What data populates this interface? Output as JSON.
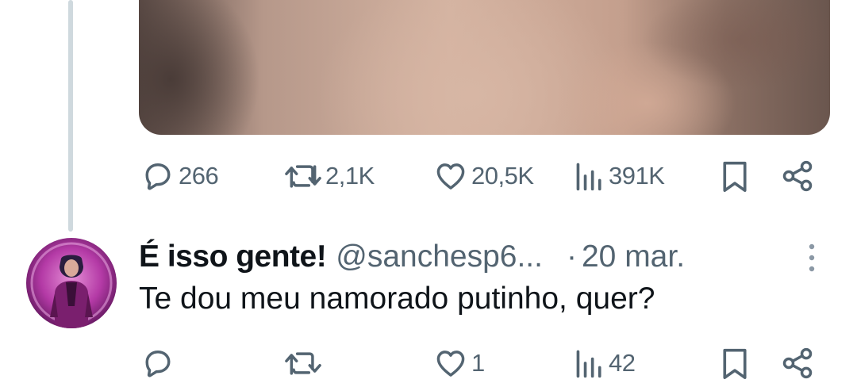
{
  "tweet": {
    "media": {
      "icon": "photo"
    },
    "stats": {
      "replies": "266",
      "retweets": "2,1K",
      "likes": "20,5K",
      "views": "391K"
    }
  },
  "reply": {
    "author_name": "É isso gente!",
    "author_handle": "@sanchesp6...",
    "separator": "·",
    "date": "20 mar.",
    "text": "Te dou meu namorado putinho, quer?",
    "stats": {
      "replies": "",
      "retweets": "",
      "likes": "1",
      "views": "42"
    }
  },
  "colors": {
    "icon_gray": "#536471",
    "text_primary": "#0f1419",
    "thread_line": "#cfd9de"
  }
}
